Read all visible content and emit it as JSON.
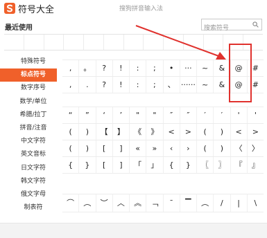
{
  "app": {
    "title": "符号大全",
    "subtitle": "搜狗拼音输入法",
    "logo_icon": "sogou-logo",
    "accent": "#f0602a"
  },
  "recent": {
    "label": "最近使用",
    "cells": [
      "",
      "",
      "",
      "",
      "",
      "",
      "",
      "",
      "",
      "",
      "",
      "",
      ""
    ]
  },
  "search": {
    "placeholder": "搜索符号",
    "icon": "search-icon"
  },
  "sidebar": {
    "items": [
      {
        "label": "特殊符号",
        "active": false
      },
      {
        "label": "标点符号",
        "active": true
      },
      {
        "label": "数字序号",
        "active": false
      },
      {
        "label": "数学/单位",
        "active": false
      },
      {
        "label": "希腊/拉丁",
        "active": false
      },
      {
        "label": "拼音/注音",
        "active": false
      },
      {
        "label": "中文字符",
        "active": false
      },
      {
        "label": "英文音标",
        "active": false
      },
      {
        "label": "日文字符",
        "active": false
      },
      {
        "label": "韩文字符",
        "active": false
      },
      {
        "label": "俄文字母",
        "active": false
      },
      {
        "label": "制表符",
        "active": false
      }
    ]
  },
  "punctuation_grid": {
    "rows": [
      [
        ",",
        "。",
        "?",
        "!",
        ":",
        ";",
        "•",
        "···",
        "~",
        "&",
        "@",
        "#"
      ],
      [
        ",",
        ".",
        "?",
        "!",
        ":",
        ";",
        "、",
        "······",
        "~",
        "&",
        "@",
        "#"
      ]
    ]
  },
  "bracket_grid": {
    "rows": [
      [
        "“",
        "”",
        "‘",
        "’",
        "\"",
        "\"",
        "″",
        "″",
        "′",
        "′",
        "'",
        "'"
      ],
      [
        "(",
        ")",
        "【",
        "】",
        "《",
        "》",
        "<",
        ">",
        "(",
        ")",
        "<",
        ">"
      ],
      [
        "(",
        ")",
        "[",
        "]",
        "«",
        "»",
        "‹",
        "›",
        "(",
        ")",
        "〈",
        "〉"
      ],
      [
        "{",
        "}",
        "[",
        "]",
        "「",
        "」",
        "{",
        "}",
        "〖",
        "〗",
        "『",
        "』"
      ]
    ]
  },
  "line_grid": {
    "rows": [
      [
        "⌒",
        "︵",
        "︶",
        "︿",
        "︽",
        "﹁",
        "¯",
        "▔",
        "︵",
        "/",
        "|",
        "\\"
      ]
    ]
  },
  "annotation": {
    "box_color": "#e0312d"
  }
}
